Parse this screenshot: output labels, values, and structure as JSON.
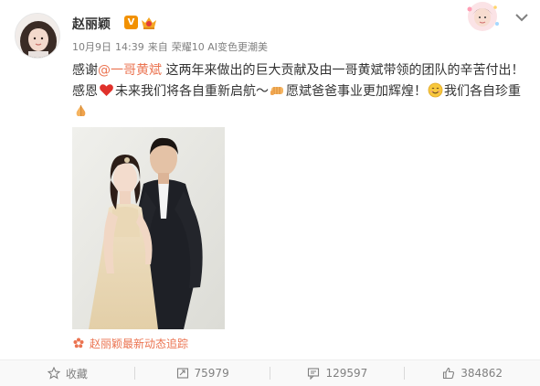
{
  "post": {
    "author": "赵丽颖",
    "verify_badge_label": "V",
    "meta": {
      "date": "10月9日",
      "time": "14:39",
      "source_prefix": "来自",
      "device": "荣耀10 AI变色更潮美"
    },
    "text": {
      "line1_prefix": "感谢",
      "mention": "@一哥黄斌",
      "line1_suffix": " 这两年来做出的巨大贡献及由一哥黄斌带领的团队的辛苦付出！",
      "line2_a": "感恩",
      "line2_b": "未来我们将各自重新启航～",
      "line2_c": "愿斌爸爸事业更加辉煌！",
      "line2_d": "我们各自珍重"
    },
    "emoji_icons": [
      "heart-emoji-icon",
      "fist-bump-emoji-icon",
      "smile-emoji-icon",
      "praying-hands-emoji-icon"
    ],
    "source_link": "赵丽颖最新动态追踪"
  },
  "actions": {
    "favorite_label": "收藏",
    "repost_count": "75979",
    "comment_count": "129597",
    "like_count": "384862"
  },
  "colors": {
    "mention": "#eb7350",
    "verify_badge": "#f29100",
    "meta_text": "#808080"
  }
}
